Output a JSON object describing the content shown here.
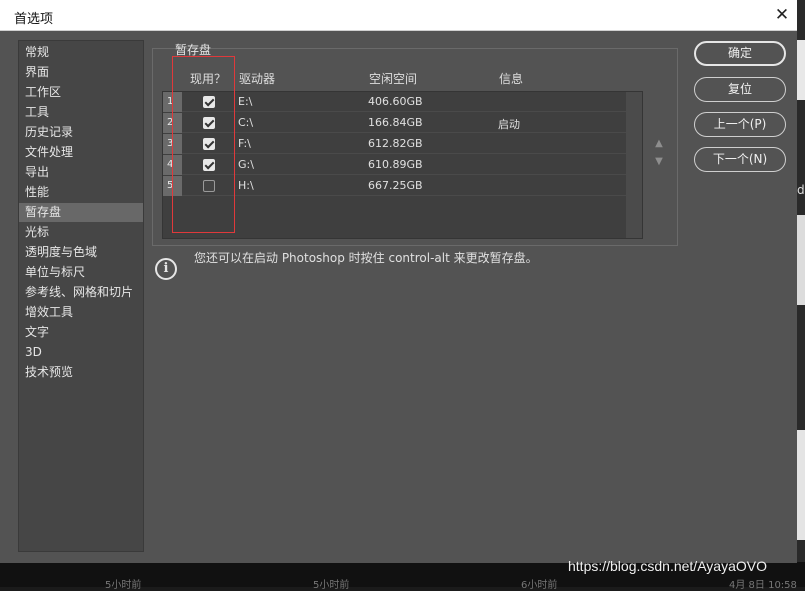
{
  "window": {
    "title": "首选项",
    "close_glyph": "✕"
  },
  "sidebar": {
    "items": [
      {
        "label": "常规"
      },
      {
        "label": "界面"
      },
      {
        "label": "工作区"
      },
      {
        "label": "工具"
      },
      {
        "label": "历史记录"
      },
      {
        "label": "文件处理"
      },
      {
        "label": "导出"
      },
      {
        "label": "性能"
      },
      {
        "label": "暂存盘",
        "selected": true
      },
      {
        "label": "光标"
      },
      {
        "label": "透明度与色域"
      },
      {
        "label": "单位与标尺"
      },
      {
        "label": "参考线、网格和切片"
      },
      {
        "label": "增效工具"
      },
      {
        "label": "文字"
      },
      {
        "label": "3D"
      },
      {
        "label": "技术预览"
      }
    ]
  },
  "scratch": {
    "group_label": "暂存盘",
    "headers": {
      "active": "现用？",
      "drive": "驱动器",
      "free": "空闲空间",
      "info": "信息"
    },
    "rows": [
      {
        "num": "1",
        "checked": true,
        "drive": "E:\\",
        "free": "406.60GB",
        "info": ""
      },
      {
        "num": "2",
        "checked": true,
        "drive": "C:\\",
        "free": "166.84GB",
        "info": "启动"
      },
      {
        "num": "3",
        "checked": true,
        "drive": "F:\\",
        "free": "612.82GB",
        "info": ""
      },
      {
        "num": "4",
        "checked": true,
        "drive": "G:\\",
        "free": "610.89GB",
        "info": ""
      },
      {
        "num": "5",
        "checked": false,
        "drive": "H:\\",
        "free": "667.25GB",
        "info": ""
      }
    ],
    "hint": "您还可以在启动 Photoshop 时按住 control-alt 来更改暂存盘。",
    "info_icon_glyph": "i",
    "up_glyph": "▲",
    "down_glyph": "▼"
  },
  "buttons": {
    "ok": "确定",
    "reset": "复位",
    "prev": "上一个(P)",
    "next": "下一个(N)"
  },
  "background": {
    "bottom_labels": [
      "5小时前",
      "5小时前",
      "6小时前",
      "4月 8日 10:58"
    ],
    "right_edge_text": "d"
  },
  "watermark": "https://blog.csdn.net/AyayaOVO",
  "colors": {
    "highlight_box": "#e0393b",
    "dialog_bg": "#535353"
  }
}
